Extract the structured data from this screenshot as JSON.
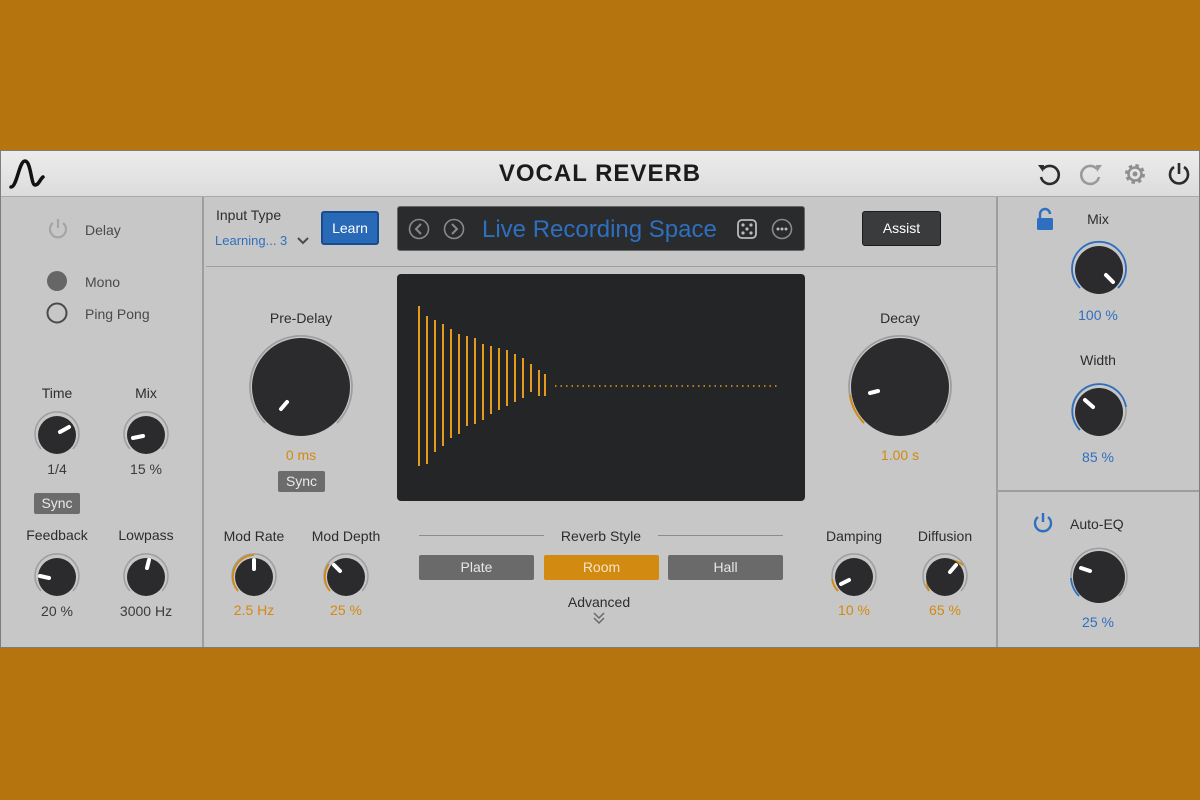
{
  "app": {
    "title": "VOCAL REVERB"
  },
  "toolbar": {
    "undo": "undo-icon",
    "redo": "redo-icon",
    "settings": "gear-icon",
    "power": "power-icon"
  },
  "delay": {
    "label": "Delay",
    "mode_mono": "Mono",
    "mode_pingpong": "Ping Pong",
    "time": {
      "label": "Time",
      "value": "1/4",
      "sync": "Sync"
    },
    "mix": {
      "label": "Mix",
      "value": "15 %"
    },
    "feedback": {
      "label": "Feedback",
      "value": "20 %"
    },
    "lowpass": {
      "label": "Lowpass",
      "value": "3000 Hz"
    }
  },
  "input": {
    "label": "Input Type",
    "value": "Learning... 3",
    "learn": "Learn"
  },
  "preset": {
    "name": "Live Recording Space"
  },
  "assist": "Assist",
  "predelay": {
    "label": "Pre-Delay",
    "value": "0 ms",
    "sync": "Sync"
  },
  "decay": {
    "label": "Decay",
    "value": "1.00 s"
  },
  "mod_rate": {
    "label": "Mod Rate",
    "value": "2.5 Hz"
  },
  "mod_depth": {
    "label": "Mod Depth",
    "value": "25 %"
  },
  "reverb_style": {
    "label": "Reverb Style",
    "options": [
      "Plate",
      "Room",
      "Hall"
    ],
    "selected": "Room",
    "advanced": "Advanced"
  },
  "damping": {
    "label": "Damping",
    "value": "10 %"
  },
  "diffusion": {
    "label": "Diffusion",
    "value": "65 %"
  },
  "output": {
    "mix": {
      "label": "Mix",
      "value": "100 %"
    },
    "width": {
      "label": "Width",
      "value": "85 %"
    },
    "auto_eq": {
      "label": "Auto-EQ",
      "value": "25 %"
    }
  },
  "colors": {
    "accent_orange": "#d28a10",
    "accent_blue": "#2f6fc0",
    "background": "#b5740e",
    "panel": "#c7c7c7"
  }
}
